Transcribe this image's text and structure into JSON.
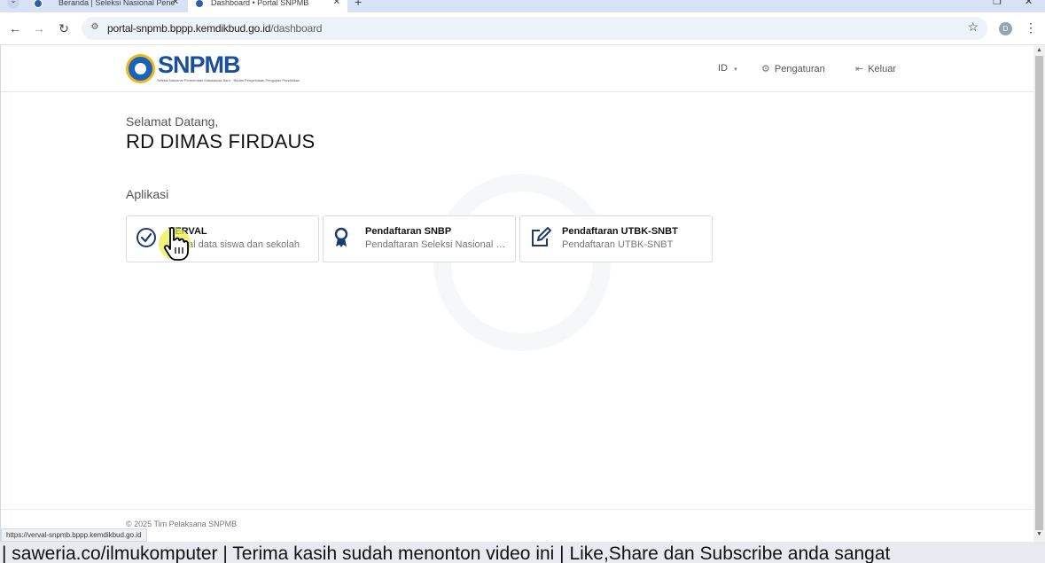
{
  "browser": {
    "tabs": [
      {
        "title": "Beranda | Seleksi Nasional Pene"
      },
      {
        "title": "Dashboard • Portal SNPMB"
      }
    ],
    "new_tab": "+",
    "url_host": "portal-snpmb.bppp.kemdikbud.go.id",
    "url_path": "/dashboard",
    "profile_initial": "D"
  },
  "header": {
    "logo_text": "SNPMB",
    "logo_sub": "Seleksi Nasional Penerimaan Mahasiswa Baru · Badan Pengelolaan Pengujian Pendidikan",
    "lang": "ID",
    "settings": "Pengaturan",
    "logout": "Keluar"
  },
  "main": {
    "greeting": "Selamat Datang,",
    "user_name": "RD DIMAS FIRDAUS",
    "section_title": "Aplikasi",
    "apps": [
      {
        "title": "VERVAL",
        "subtitle": "Verval data siswa dan sekolah",
        "icon": "check-circle-icon"
      },
      {
        "title": "Pendaftaran SNBP",
        "subtitle": "Pendaftaran Seleksi Nasional Berdasarkan Prestasi",
        "icon": "award-icon"
      },
      {
        "title": "Pendaftaran UTBK-SNBT",
        "subtitle": "Pendaftaran UTBK-SNBT",
        "icon": "edit-icon"
      }
    ]
  },
  "footer": {
    "copyright": "© 2025 Tim Pelaksana SNPMB"
  },
  "status_bar": {
    "hover_url": "https://verval-snpmb.bppp.kemdikbud.go.id"
  },
  "ticker": {
    "text": "| saweria.co/ilmukomputer  | Terima kasih sudah menonton video ini | Like,Share dan Subscribe anda sangat"
  },
  "colors": {
    "brand": "#1a4f9c",
    "icon": "#1e3a6e",
    "chrome": "#d7e3f4"
  }
}
